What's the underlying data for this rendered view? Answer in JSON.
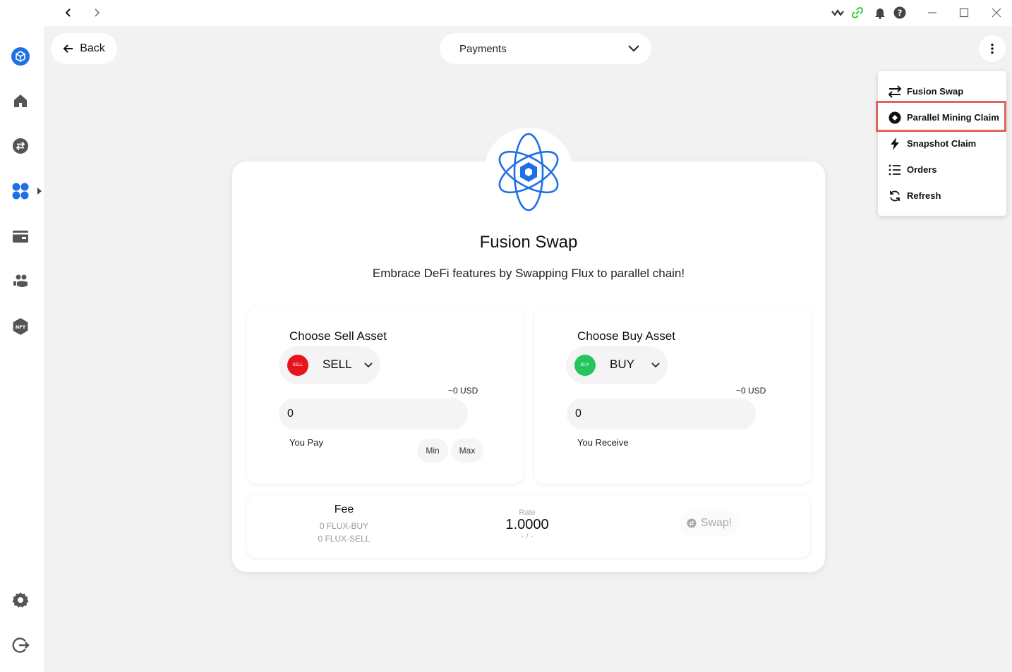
{
  "titlebar": {
    "back_icon": "chevron-left-icon",
    "forward_icon": "chevron-right-icon",
    "status_icons": [
      "wave-icon",
      "link-icon",
      "bell-icon",
      "help-icon"
    ],
    "window_controls": [
      "minimize-icon",
      "maximize-icon",
      "close-icon"
    ]
  },
  "sidebar": {
    "items": [
      {
        "name": "cube-icon",
        "active": true
      },
      {
        "name": "home-icon"
      },
      {
        "name": "transfer-icon"
      },
      {
        "name": "apps-icon",
        "active": true
      },
      {
        "name": "wallet-icon"
      },
      {
        "name": "users-icon"
      },
      {
        "name": "nft-icon",
        "label": "NFT"
      },
      {
        "name": "settings-icon"
      },
      {
        "name": "logout-icon"
      }
    ],
    "accent": "#1f6fe5"
  },
  "header": {
    "back_label": "Back",
    "select_value": "Payments"
  },
  "menu": {
    "items": [
      {
        "label": "Fusion Swap",
        "icon": "swap-arrows-icon"
      },
      {
        "label": "Parallel Mining Claim",
        "icon": "disc-icon",
        "highlighted": true
      },
      {
        "label": "Snapshot Claim",
        "icon": "bolt-icon"
      },
      {
        "label": "Orders",
        "icon": "list-icon"
      },
      {
        "label": "Refresh",
        "icon": "refresh-icon"
      }
    ],
    "highlight_color": "#e0645f"
  },
  "card": {
    "title": "Fusion Swap",
    "subtitle": "Embrace DeFi features by Swapping Flux to parallel chain!",
    "sell": {
      "title": "Choose Sell Asset",
      "asset": "SELL",
      "badge": "SELL",
      "badge_color": "#e8141c",
      "usd": "~0 USD",
      "amount": "0",
      "caption": "You Pay",
      "min_label": "Min",
      "max_label": "Max"
    },
    "buy": {
      "title": "Choose Buy Asset",
      "asset": "BUY",
      "badge": "BUY",
      "badge_color": "#22c55e",
      "usd": "~0 USD",
      "amount": "0",
      "caption": "You Receive"
    },
    "fee": {
      "title": "Fee",
      "line1": "0 FLUX-BUY",
      "line2": "0 FLUX-SELL"
    },
    "rate": {
      "label": "Rate",
      "value": "1.0000",
      "sub": "- / -"
    },
    "swap_label": "Swap!"
  }
}
